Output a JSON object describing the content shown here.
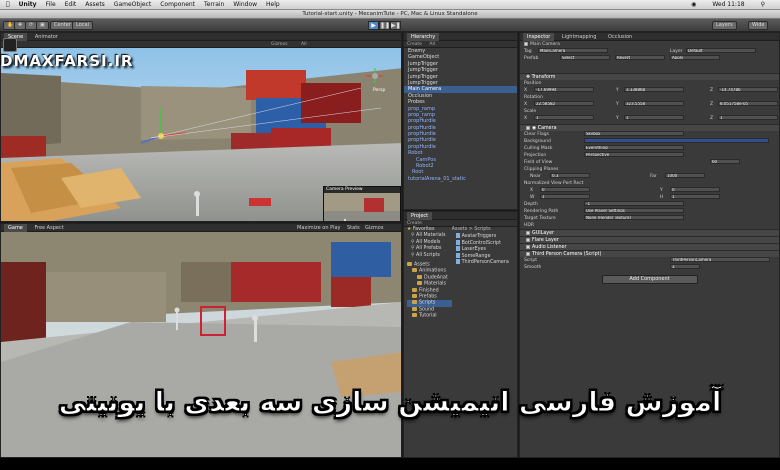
{
  "menubar": {
    "app": "Unity",
    "items": [
      "File",
      "Edit",
      "Assets",
      "GameObject",
      "Component",
      "Terrain",
      "Window",
      "Help"
    ],
    "clock": "Wed 11:18"
  },
  "window_title": "Tutorial-start.unity - MecanimTute - PC, Mac & Linux Standalone",
  "toolbar": {
    "center_label": "Center",
    "local_label": "Local",
    "layers_label": "Layers",
    "layout_label": "Wide"
  },
  "scene_panel": {
    "tabs": [
      "Scene",
      "Animator"
    ],
    "mode": "RGB",
    "gizmos_label": "Gizmos",
    "search_placeholder": "All",
    "persp_label": "Persp",
    "camera_preview_title": "Camera Preview"
  },
  "game_panel": {
    "tab": "Game",
    "aspect": "Free Aspect",
    "options": [
      "Maximize on Play",
      "Stats",
      "Gizmos"
    ]
  },
  "hierarchy": {
    "tab": "Hierarchy",
    "create_label": "Create",
    "search_placeholder": "All",
    "items": [
      {
        "label": "Enemy",
        "selected": false,
        "prefab": false
      },
      {
        "label": "GameObject",
        "selected": false,
        "prefab": false
      },
      {
        "label": "JumpTrigger",
        "selected": false,
        "prefab": false
      },
      {
        "label": "JumpTrigger",
        "selected": false,
        "prefab": false
      },
      {
        "label": "JumpTrigger",
        "selected": false,
        "prefab": false
      },
      {
        "label": "JumpTrigger",
        "selected": false,
        "prefab": false
      },
      {
        "label": "Main Camera",
        "selected": true,
        "prefab": false
      },
      {
        "label": "Occlusion",
        "selected": false,
        "prefab": false
      },
      {
        "label": "Probes",
        "selected": false,
        "prefab": false
      },
      {
        "label": "prop_ramp",
        "selected": false,
        "prefab": true
      },
      {
        "label": "prop_ramp",
        "selected": false,
        "prefab": true
      },
      {
        "label": "propHurdle",
        "selected": false,
        "prefab": true
      },
      {
        "label": "propHurdle",
        "selected": false,
        "prefab": true
      },
      {
        "label": "propHurdle",
        "selected": false,
        "prefab": true
      },
      {
        "label": "propHurdle",
        "selected": false,
        "prefab": true
      },
      {
        "label": "propHurdle",
        "selected": false,
        "prefab": true
      },
      {
        "label": "Robot",
        "selected": false,
        "prefab": true
      },
      {
        "label": "CamPos",
        "selected": false,
        "prefab": true
      },
      {
        "label": "Robot2",
        "selected": false,
        "prefab": true
      },
      {
        "label": "Root",
        "selected": false,
        "prefab": true
      },
      {
        "label": "tutorialArena_01_static",
        "selected": false,
        "prefab": true
      }
    ]
  },
  "project": {
    "tab": "Project",
    "create_label": "Create",
    "favorites_label": "Favorites",
    "favorites": [
      "All Materials",
      "All Models",
      "All Prefabs",
      "All Scripts"
    ],
    "assets_label": "Assets",
    "asset_tree": [
      "Animations",
      "DudeAnat",
      "Materials",
      "Finished",
      "Prefabs",
      "Scripts",
      "Sound",
      "Tutorial"
    ],
    "breadcrumb": "Assets > Scripts",
    "files": [
      "AvatarTriggers",
      "BotControlScript",
      "LaserEyes",
      "SomeRange",
      "ThirdPersonCamera"
    ]
  },
  "inspector": {
    "tabs": [
      "Inspector",
      "Lightmapping",
      "Occlusion"
    ],
    "object_name": "Main Camera",
    "tag_label": "Tag",
    "tag_value": "MainCamera",
    "layer_label": "Layer",
    "layer_value": "Default",
    "prefab_label": "Prefab",
    "prefab_buttons": [
      "Select",
      "Revert",
      "Apply"
    ],
    "transform": {
      "title": "Transform",
      "position_label": "Position",
      "position": {
        "x": "-17.69994",
        "y": "3.338868",
        "z": "-14.74786"
      },
      "rotation_label": "Rotation",
      "rotation": {
        "x": "22.58582",
        "y": "323.5558",
        "z": "8.051758e-05"
      },
      "scale_label": "Scale",
      "scale": {
        "x": "1",
        "y": "1",
        "z": "1"
      }
    },
    "camera": {
      "title": "Camera",
      "rows": [
        {
          "label": "Clear Flags",
          "value": "Skybox"
        },
        {
          "label": "Background",
          "value": ""
        },
        {
          "label": "Culling Mask",
          "value": "Everything"
        },
        {
          "label": "Projection",
          "value": "Perspective"
        },
        {
          "label": "Field of View",
          "value": "60"
        },
        {
          "label": "Clipping Planes",
          "value": ""
        },
        {
          "label": "Normalized View Port Rect",
          "value": ""
        },
        {
          "label": "Depth",
          "value": "-1"
        },
        {
          "label": "Rendering Path",
          "value": "Use Player Settings"
        },
        {
          "label": "Target Texture",
          "value": "None (Render Texture)"
        },
        {
          "label": "HDR",
          "value": ""
        }
      ],
      "near_label": "Near",
      "near": "0.3",
      "far_label": "Far",
      "far": "1000",
      "x": "0",
      "y": "0",
      "w": "1",
      "h": "1"
    },
    "components": [
      {
        "label": "GUILayer"
      },
      {
        "label": "Flare Layer"
      },
      {
        "label": "Audio Listener"
      },
      {
        "label": "Third Person Camera (Script)"
      }
    ],
    "script_label": "Script",
    "script_value": "ThirdPersonCamera",
    "smooth_label": "Smooth",
    "smooth_value": "3",
    "add_component": "Add Component"
  },
  "watermark": "DMAXFARSI.IR",
  "banner_text": "آموزش فارسی انیمیشن سازی سه بعدی با یونیتی",
  "colors": {
    "selection": "#3c5f91",
    "play_active": "#4f86c8",
    "panel_bg": "#3a3a3a"
  }
}
